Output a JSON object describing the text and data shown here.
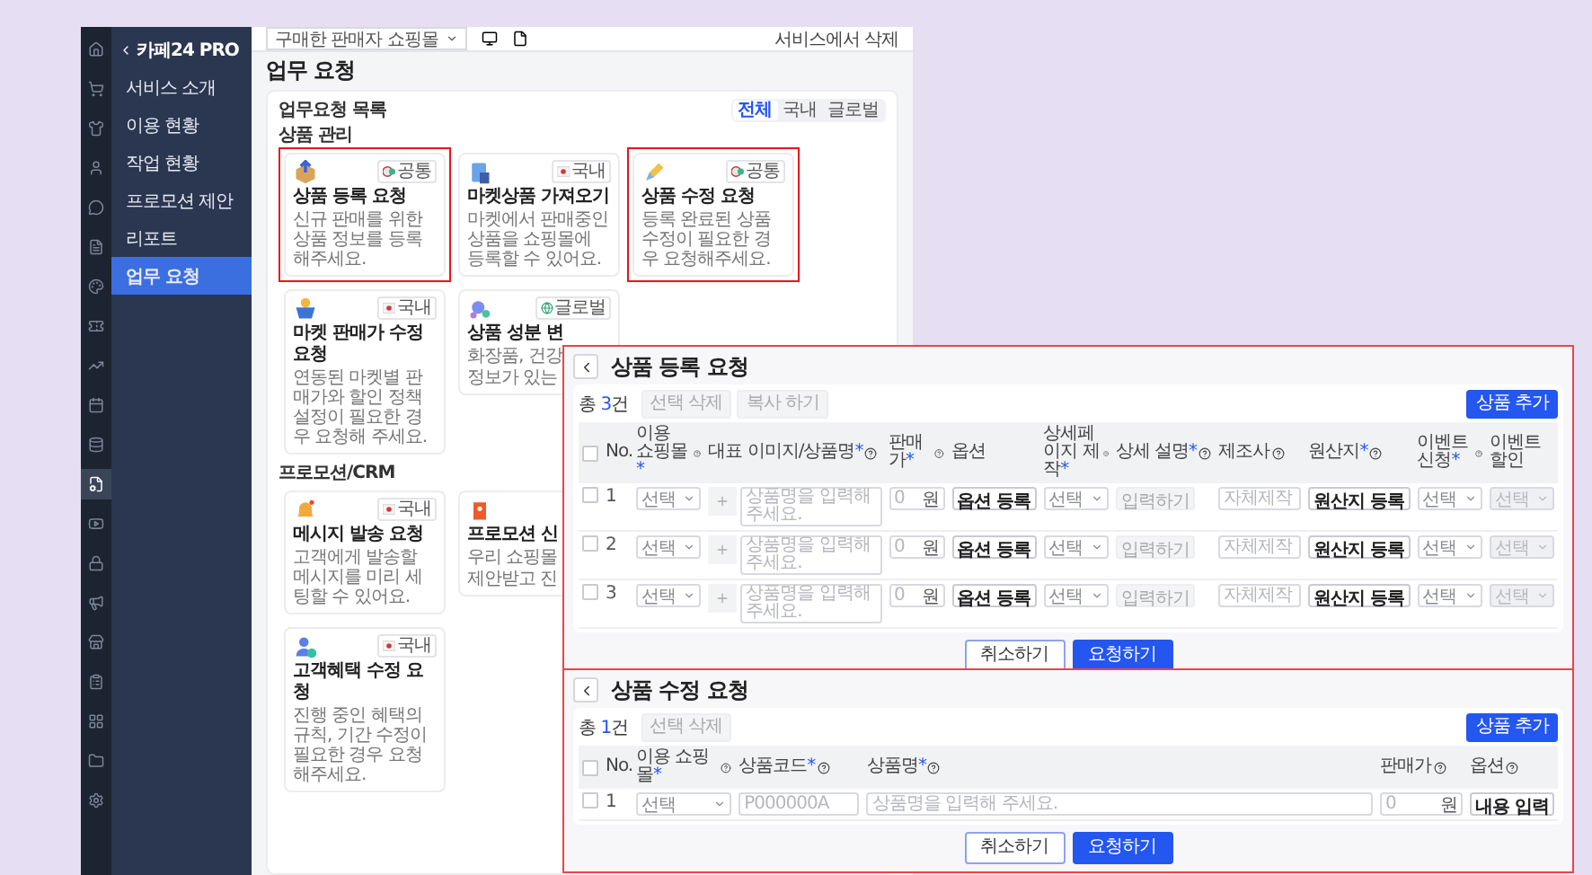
{
  "rail": [
    {
      "selected": false
    },
    {
      "selected": false
    },
    {
      "selected": false
    },
    {
      "selected": false
    },
    {
      "selected": false
    },
    {
      "selected": false
    },
    {
      "selected": false
    },
    {
      "selected": false
    },
    {
      "selected": false
    },
    {
      "selected": false
    },
    {
      "selected": false
    },
    {
      "selected": true
    },
    {
      "selected": false
    },
    {
      "selected": false
    },
    {
      "selected": false
    },
    {
      "selected": false
    },
    {
      "selected": false
    },
    {
      "selected": false
    },
    {
      "selected": false
    },
    {
      "selected": false
    }
  ],
  "sidebar": {
    "back_label": "카페24 PRO",
    "items": [
      {
        "label": "서비스 소개",
        "selected": false
      },
      {
        "label": "이용 현황",
        "selected": false
      },
      {
        "label": "작업 현황",
        "selected": false
      },
      {
        "label": "프로모션 제안",
        "selected": false
      },
      {
        "label": "리포트",
        "selected": false
      },
      {
        "label": "업무 요청",
        "selected": true
      }
    ]
  },
  "topbar": {
    "shop_select": "구매한 판매자 쇼핑몰",
    "right_text": "서비스에서 삭제"
  },
  "page": {
    "title": "업무 요청",
    "list_title": "업무요청 목록",
    "filters": [
      {
        "label": "전체",
        "selected": true
      },
      {
        "label": "국내",
        "selected": false
      },
      {
        "label": "글로벌",
        "selected": false
      }
    ],
    "sections": [
      {
        "label": "상품 관리",
        "rows": [
          [
            {
              "kind": "full",
              "title": "상품 등록 요청",
              "badge": {
                "kind": "common",
                "label": "공통"
              },
              "description": "신규 판매를 위한 상품 정보를 등록해주세요.",
              "highlighted": true
            },
            {
              "kind": "full",
              "title": "마켓상품 가져오기",
              "badge": {
                "kind": "domestic",
                "label": "국내"
              },
              "description": "마켓에서 판매중인 상품을 쇼핑몰에 등록할 수 있어요.",
              "highlighted": false
            },
            {
              "kind": "full",
              "title": "상품 수정 요청",
              "badge": {
                "kind": "common",
                "label": "공통"
              },
              "description": "등록 완료된 상품 수정이 필요한 경우 요청해주세요.",
              "highlighted": true
            }
          ],
          [
            {
              "kind": "full",
              "title": "마켓 판매가 수정 요청",
              "badge": {
                "kind": "domestic",
                "label": "국내"
              },
              "description": "연동된 마켓별 판매가와 할인 정책 설정이 필요한 경우 요청해 주세요.",
              "highlighted": false
            },
            {
              "kind": "cut",
              "title": "상품 성분 변",
              "badge": {
                "kind": "global",
                "label": "글로벌"
              },
              "description_lines": [
                "화장품, 건강",
                "정보가 있는"
              ],
              "highlighted": false
            }
          ]
        ]
      },
      {
        "label": "프로모션/CRM",
        "rows": [
          [
            {
              "kind": "full",
              "title": "메시지 발송 요청",
              "badge": {
                "kind": "domestic",
                "label": "국내"
              },
              "description": "고객에게 발송할 메시지를 미리 세팅할 수 있어요.",
              "highlighted": false
            },
            {
              "kind": "cut",
              "title": "프로모션 신",
              "description_lines": [
                "우리 쇼핑몰",
                "제안받고 진"
              ],
              "highlighted": false
            }
          ],
          [
            {
              "kind": "full",
              "title": "고객혜택 수정 요청",
              "badge": {
                "kind": "domestic",
                "label": "국내"
              },
              "description": "진행 중인 혜택의 규칙, 기간 수정이 필요한 경우 요청해주세요.",
              "highlighted": false
            }
          ]
        ]
      }
    ]
  },
  "panels": [
    {
      "title": "상품 등록 요청",
      "total_label": "총",
      "total_count": "3",
      "total_unit": "건",
      "toolbar_buttons": [
        "선택 삭제",
        "복사 하기"
      ],
      "add_button": "상품 추가",
      "columns": [
        {
          "kind": "checkbox",
          "checked": false
        },
        {
          "label": "No."
        },
        {
          "label": "이용 쇼핑몰",
          "required_mark": "*",
          "help": true
        },
        {
          "label": "대표 이미지/상품명",
          "required_mark": "*",
          "help": true
        },
        {
          "label": "판매가",
          "required_mark": "*",
          "help": true
        },
        {
          "label": "옵션"
        },
        {
          "label": "상세페이지 제작",
          "required_mark": "*",
          "help": true
        },
        {
          "label": "상세 설명",
          "required_mark": "*",
          "help": true
        },
        {
          "label": "제조사",
          "help": true
        },
        {
          "label": "원산지",
          "required_mark": "*",
          "help": true
        },
        {
          "label": "이벤트 신청",
          "required_mark": "*",
          "help": true
        },
        {
          "label": "이벤트 할인"
        }
      ],
      "rows": [
        {
          "cells": [
            {
              "kind": "checkbox",
              "checked": false
            },
            {
              "kind": "number",
              "text": "1"
            },
            {
              "kind": "select",
              "value": "선택",
              "disabled": false
            },
            {
              "kind": "image_name",
              "placeholder": "상품명을 입력해 주세요."
            },
            {
              "kind": "price",
              "placeholder": "0",
              "unit": "원"
            },
            {
              "kind": "button",
              "label": "옵션 등록"
            },
            {
              "kind": "select",
              "value": "선택",
              "disabled": false
            },
            {
              "kind": "chip",
              "label": "입력하기"
            },
            {
              "kind": "input",
              "placeholder": "자체제작"
            },
            {
              "kind": "button",
              "label": "원산지 등록"
            },
            {
              "kind": "select",
              "value": "선택",
              "disabled": false
            },
            {
              "kind": "select",
              "value": "선택",
              "disabled": true
            }
          ]
        },
        {
          "cells": [
            {
              "kind": "checkbox",
              "checked": false
            },
            {
              "kind": "number",
              "text": "2"
            },
            {
              "kind": "select",
              "value": "선택",
              "disabled": false
            },
            {
              "kind": "image_name",
              "placeholder": "상품명을 입력해 주세요."
            },
            {
              "kind": "price",
              "placeholder": "0",
              "unit": "원"
            },
            {
              "kind": "button",
              "label": "옵션 등록"
            },
            {
              "kind": "select",
              "value": "선택",
              "disabled": false
            },
            {
              "kind": "chip",
              "label": "입력하기"
            },
            {
              "kind": "input",
              "placeholder": "자체제작"
            },
            {
              "kind": "button",
              "label": "원산지 등록"
            },
            {
              "kind": "select",
              "value": "선택",
              "disabled": false
            },
            {
              "kind": "select",
              "value": "선택",
              "disabled": true
            }
          ]
        },
        {
          "cells": [
            {
              "kind": "checkbox",
              "checked": false
            },
            {
              "kind": "number",
              "text": "3"
            },
            {
              "kind": "select",
              "value": "선택",
              "disabled": false
            },
            {
              "kind": "image_name",
              "placeholder": "상품명을 입력해 주세요."
            },
            {
              "kind": "price",
              "placeholder": "0",
              "unit": "원"
            },
            {
              "kind": "button",
              "label": "옵션 등록"
            },
            {
              "kind": "select",
              "value": "선택",
              "disabled": false
            },
            {
              "kind": "chip",
              "label": "입력하기"
            },
            {
              "kind": "input",
              "placeholder": "자체제작"
            },
            {
              "kind": "button",
              "label": "원산지 등록"
            },
            {
              "kind": "select",
              "value": "선택",
              "disabled": false
            },
            {
              "kind": "select",
              "value": "선택",
              "disabled": true
            }
          ]
        }
      ],
      "footer_buttons": [
        {
          "kind": "secondary",
          "label": "취소하기"
        },
        {
          "kind": "primary",
          "label": "요청하기"
        }
      ]
    },
    {
      "title": "상품 수정 요청",
      "total_label": "총",
      "total_count": "1",
      "total_unit": "건",
      "toolbar_buttons": [
        "선택 삭제"
      ],
      "add_button": "상품 추가",
      "columns": [
        {
          "kind": "checkbox",
          "checked": false
        },
        {
          "label": "No."
        },
        {
          "label": "이용 쇼핑몰",
          "required_mark": "*",
          "help": true
        },
        {
          "label": "상품코드",
          "required_mark": "*",
          "help": true
        },
        {
          "label": "상품명",
          "required_mark": "*",
          "help": true
        },
        {
          "label": "판매가",
          "help": true
        },
        {
          "label": "옵션",
          "help": true
        }
      ],
      "rows": [
        {
          "cells": [
            {
              "kind": "checkbox",
              "checked": false
            },
            {
              "kind": "number",
              "text": "1"
            },
            {
              "kind": "select",
              "value": "선택",
              "disabled": false
            },
            {
              "kind": "input",
              "placeholder": "P000000A"
            },
            {
              "kind": "text",
              "placeholder": "상품명을 입력해 주세요."
            },
            {
              "kind": "price",
              "placeholder": "0",
              "unit": "원"
            },
            {
              "kind": "button",
              "label": "내용 입력"
            }
          ]
        }
      ],
      "footer_buttons": [
        {
          "kind": "secondary",
          "label": "취소하기"
        },
        {
          "kind": "primary",
          "label": "요청하기"
        }
      ]
    }
  ]
}
